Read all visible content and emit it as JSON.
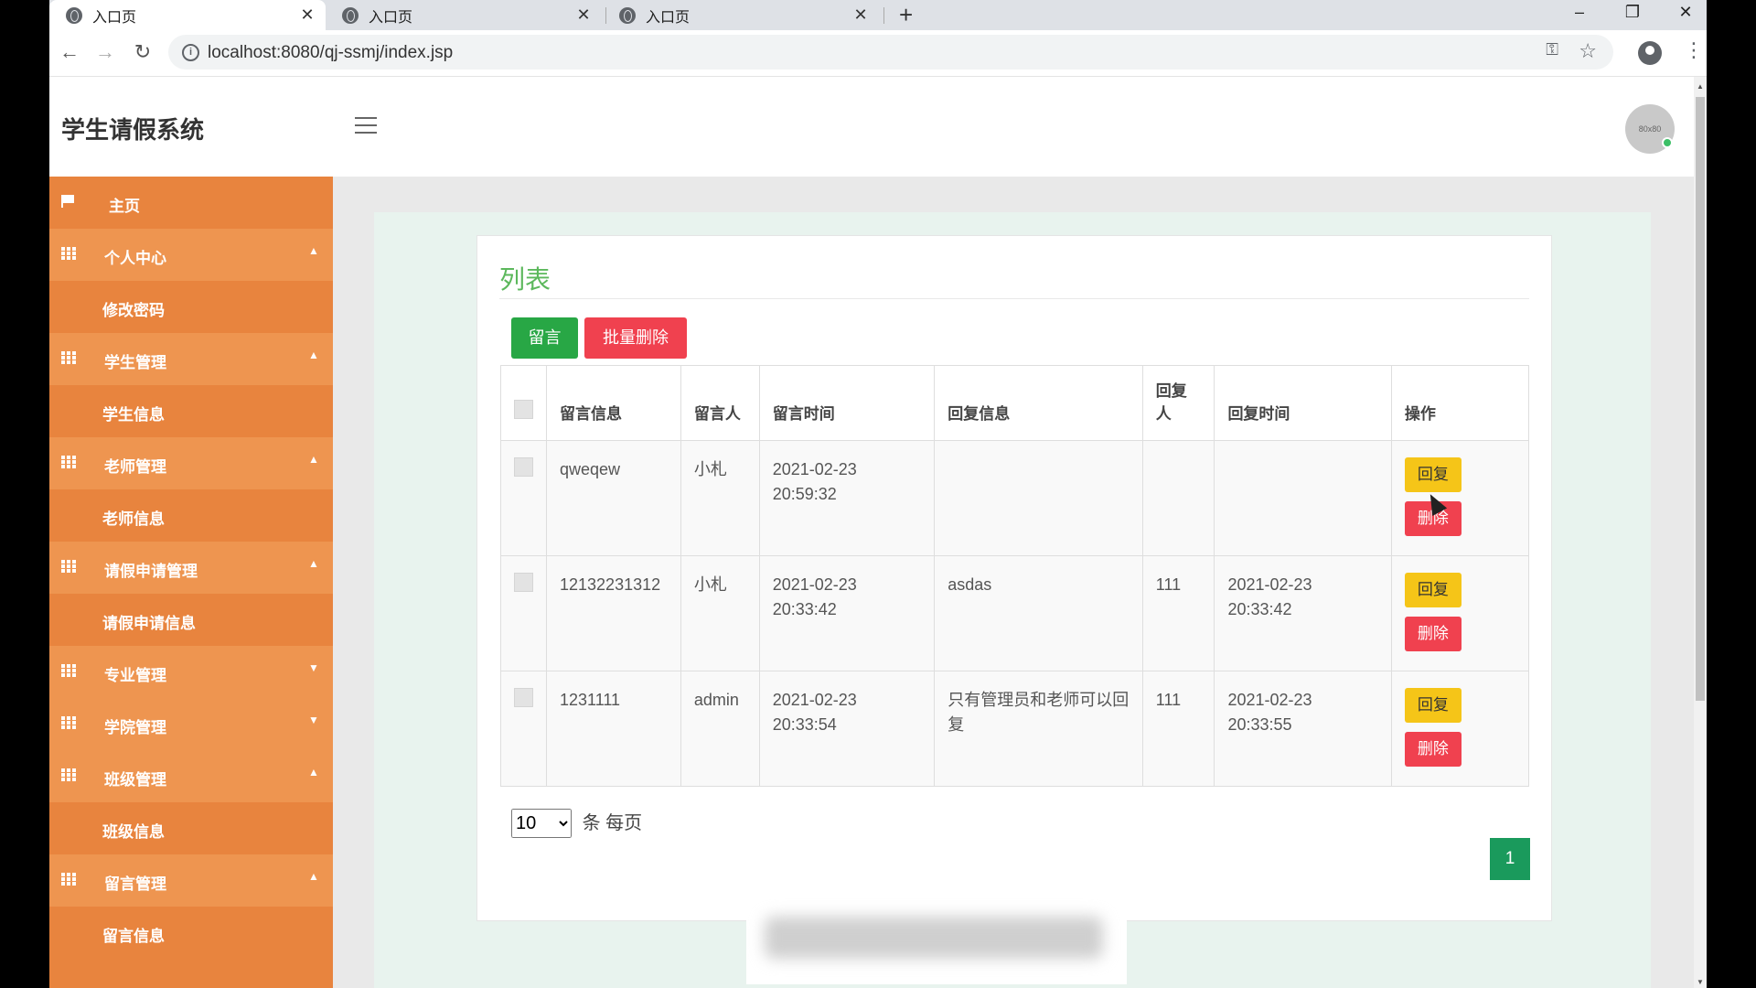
{
  "browser": {
    "tabs": [
      {
        "label": "入口页",
        "close": "✕"
      },
      {
        "label": "入口页",
        "close": "✕"
      },
      {
        "label": "入口页",
        "close": "✕"
      }
    ],
    "new_tab": "+",
    "window_controls": {
      "minimize": "–",
      "restore": "❐",
      "close": "✕"
    },
    "nav": {
      "back": "←",
      "forward": "→",
      "reload": "↻"
    },
    "url": "localhost:8080/qj-ssmj/index.jsp",
    "info_icon": "i",
    "key_icon": "⚿",
    "star_icon": "☆",
    "menu_icon": "⋮"
  },
  "app": {
    "title": "学生请假系统",
    "avatar_text": "80x80"
  },
  "sidebar": {
    "items": [
      {
        "label": "主页",
        "type": "top",
        "icon": "flag-icon",
        "caret": ""
      },
      {
        "label": "个人中心",
        "type": "group",
        "icon": "grid-icon",
        "caret": "▲"
      },
      {
        "label": "修改密码",
        "type": "sub",
        "caret": ""
      },
      {
        "label": "学生管理",
        "type": "group",
        "icon": "grid-icon",
        "caret": "▲"
      },
      {
        "label": "学生信息",
        "type": "sub",
        "caret": ""
      },
      {
        "label": "老师管理",
        "type": "group",
        "icon": "grid-icon",
        "caret": "▲"
      },
      {
        "label": "老师信息",
        "type": "sub",
        "caret": ""
      },
      {
        "label": "请假申请管理",
        "type": "group",
        "icon": "grid-icon",
        "caret": "▲"
      },
      {
        "label": "请假申请信息",
        "type": "sub",
        "caret": ""
      },
      {
        "label": "专业管理",
        "type": "group",
        "icon": "grid-icon",
        "caret": "▼"
      },
      {
        "label": "学院管理",
        "type": "group",
        "icon": "grid-icon",
        "caret": "▼"
      },
      {
        "label": "班级管理",
        "type": "group",
        "icon": "grid-icon",
        "caret": "▲"
      },
      {
        "label": "班级信息",
        "type": "sub",
        "caret": ""
      },
      {
        "label": "留言管理",
        "type": "group",
        "icon": "grid-icon",
        "caret": "▲"
      },
      {
        "label": "留言信息",
        "type": "sub",
        "caret": ""
      }
    ]
  },
  "main": {
    "card_title": "列表",
    "buttons": {
      "add": "留言",
      "batch_delete": "批量删除"
    },
    "table": {
      "headers": [
        "留言信息",
        "留言人",
        "留言时间",
        "回复信息",
        "回复人",
        "回复时间",
        "操作"
      ],
      "rows": [
        {
          "message": "qweqew",
          "author": "小札",
          "time": "2021-02-23 20:59:32",
          "reply": "",
          "replier": "",
          "reply_time": ""
        },
        {
          "message": "12132231312",
          "author": "小札",
          "time": "2021-02-23 20:33:42",
          "reply": "asdas",
          "replier": "111",
          "reply_time": "2021-02-23 20:33:42"
        },
        {
          "message": "1231111",
          "author": "admin",
          "time": "2021-02-23 20:33:54",
          "reply": "只有管理员和老师可以回复",
          "replier": "111",
          "reply_time": "2021-02-23 20:33:55"
        }
      ],
      "action_labels": {
        "reply": "回复",
        "delete": "删除"
      }
    },
    "page_size": {
      "selected": "10",
      "suffix": "条 每页"
    },
    "pagination": {
      "current": "1"
    }
  },
  "colors": {
    "sidebar": "#e8843e",
    "sidebar_group": "#ee9550",
    "accent_green": "#28a745",
    "danger": "#f0414f",
    "warning": "#f5c518",
    "page_active": "#1a9a5c"
  }
}
